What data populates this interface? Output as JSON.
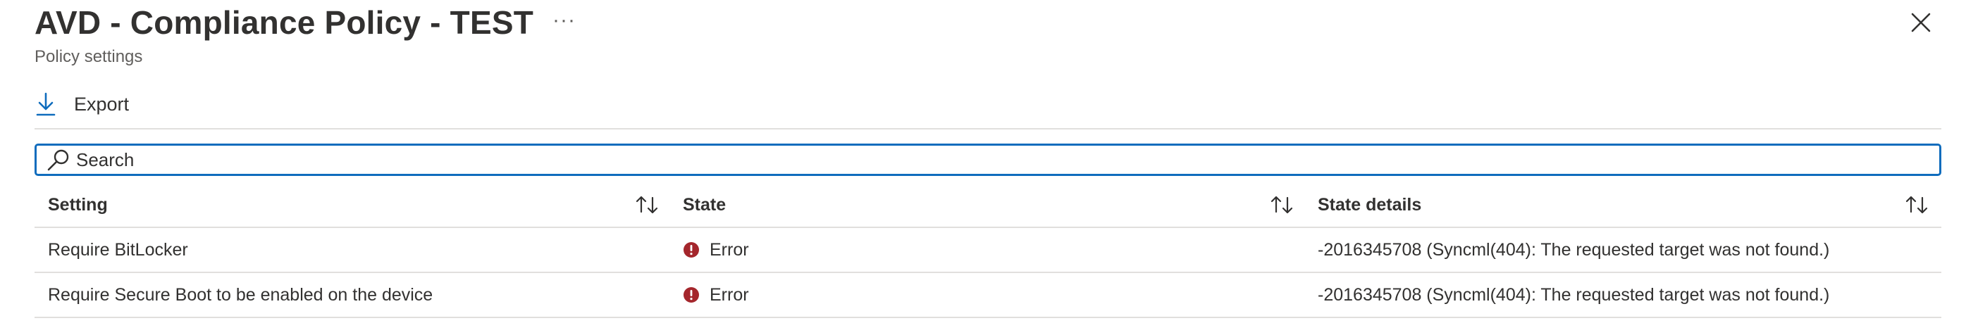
{
  "header": {
    "title": "AVD - Compliance Policy - TEST",
    "more_label": "···",
    "subtitle": "Policy settings",
    "close_icon": "close-icon"
  },
  "toolbar": {
    "export_label": "Export",
    "export_icon": "download-icon",
    "accent": "#0f6cbd"
  },
  "search": {
    "placeholder": "Search",
    "value": ""
  },
  "table": {
    "columns": [
      "Setting",
      "State",
      "State details"
    ],
    "rows": [
      {
        "setting": "Require BitLocker",
        "state": "Error",
        "details": "-2016345708 (Syncml(404): The requested target was not found.)"
      },
      {
        "setting": "Require Secure Boot to be enabled on the device",
        "state": "Error",
        "details": "-2016345708 (Syncml(404): The requested target was not found.)"
      }
    ],
    "error_color": "#a4262c"
  }
}
